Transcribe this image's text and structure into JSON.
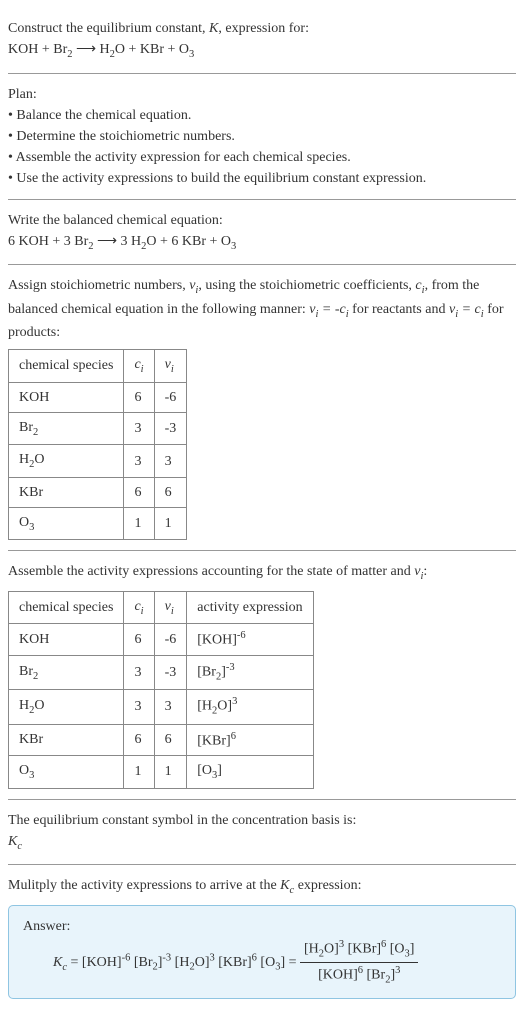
{
  "header": {
    "line1": "Construct the equilibrium constant, ",
    "k": "K",
    "line1b": ", expression for:",
    "eq": "KOH + Br₂ ⟶ H₂O + KBr + O₃"
  },
  "plan": {
    "title": "Plan:",
    "b1": "• Balance the chemical equation.",
    "b2": "• Determine the stoichiometric numbers.",
    "b3": "• Assemble the activity expression for each chemical species.",
    "b4": "• Use the activity expressions to build the equilibrium constant expression."
  },
  "balanced": {
    "title": "Write the balanced chemical equation:",
    "eq": "6 KOH + 3 Br₂ ⟶ 3 H₂O + 6 KBr + O₃"
  },
  "stoich": {
    "text1": "Assign stoichiometric numbers, ",
    "nu": "νᵢ",
    "text2": ", using the stoichiometric coefficients, ",
    "ci": "cᵢ",
    "text3": ", from the balanced chemical equation in the following manner: ",
    "rel1": "νᵢ = -cᵢ",
    "text4": " for reactants and ",
    "rel2": "νᵢ = cᵢ",
    "text5": " for products:",
    "h1": "chemical species",
    "h2": "cᵢ",
    "h3": "νᵢ",
    "r1c1": "KOH",
    "r1c2": "6",
    "r1c3": "-6",
    "r2c1": "Br₂",
    "r2c2": "3",
    "r2c3": "-3",
    "r3c1": "H₂O",
    "r3c2": "3",
    "r3c3": "3",
    "r4c1": "KBr",
    "r4c2": "6",
    "r4c3": "6",
    "r5c1": "O₃",
    "r5c2": "1",
    "r5c3": "1"
  },
  "activity": {
    "text1": "Assemble the activity expressions accounting for the state of matter and ",
    "nu": "νᵢ",
    "text2": ":",
    "h1": "chemical species",
    "h2": "cᵢ",
    "h3": "νᵢ",
    "h4": "activity expression",
    "r1c1": "KOH",
    "r1c2": "6",
    "r1c3": "-6",
    "r1c4": "[KOH]⁻⁶",
    "r2c1": "Br₂",
    "r2c2": "3",
    "r2c3": "-3",
    "r2c4": "[Br₂]⁻³",
    "r3c1": "H₂O",
    "r3c2": "3",
    "r3c3": "3",
    "r3c4": "[H₂O]³",
    "r4c1": "KBr",
    "r4c2": "6",
    "r4c3": "6",
    "r4c4": "[KBr]⁶",
    "r5c1": "O₃",
    "r5c2": "1",
    "r5c3": "1",
    "r5c4": "[O₃]"
  },
  "symbol": {
    "text": "The equilibrium constant symbol in the concentration basis is:",
    "kc": "Kc"
  },
  "final": {
    "text": "Mulitply the activity expressions to arrive at the ",
    "kc": "Kc",
    "text2": " expression:",
    "answer_label": "Answer:",
    "lhs": "Kc = [KOH]⁻⁶ [Br₂]⁻³ [H₂O]³ [KBr]⁶ [O₃] = ",
    "num": "[H₂O]³ [KBr]⁶ [O₃]",
    "den": "[KOH]⁶ [Br₂]³"
  }
}
